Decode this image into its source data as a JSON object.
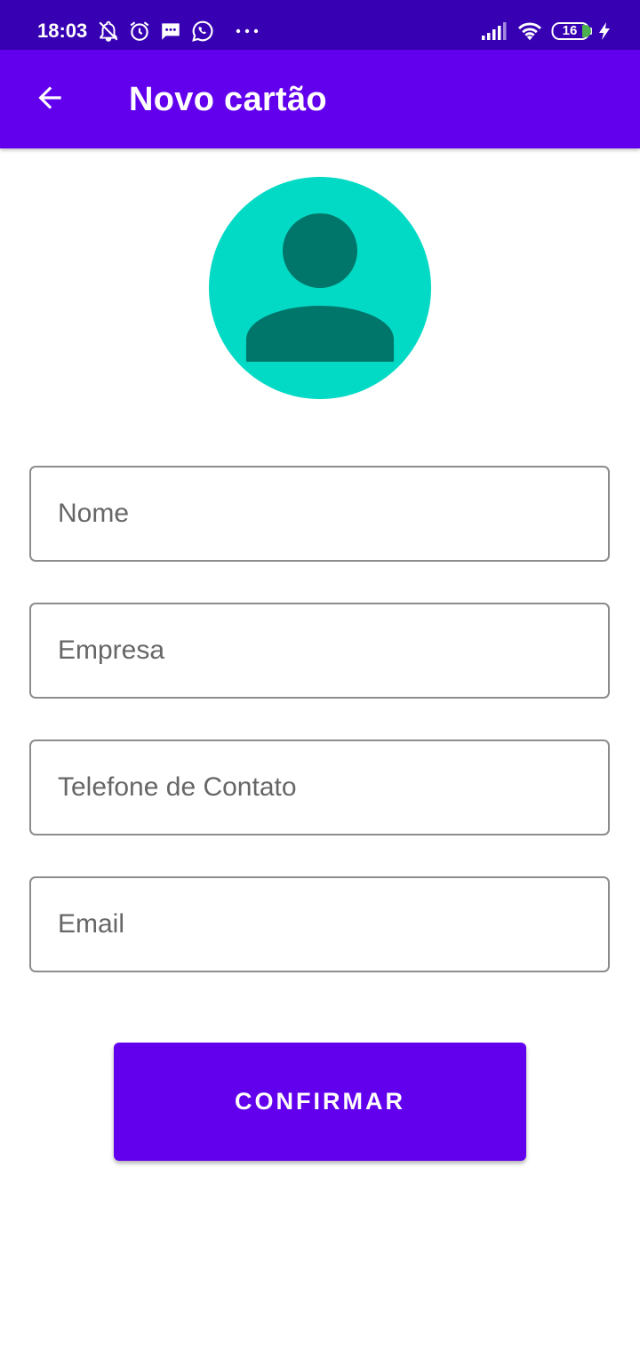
{
  "status_bar": {
    "time": "18:03",
    "battery_level": "16",
    "icons": [
      "notifications-off-icon",
      "alarm-icon",
      "message-icon",
      "whatsapp-icon",
      "more-dots-icon",
      "signal-icon",
      "wifi-icon",
      "battery-icon",
      "charging-icon"
    ]
  },
  "app_bar": {
    "back_icon": "arrow-left-icon",
    "title": "Novo cartão"
  },
  "avatar": {
    "icon": "person-icon",
    "background_color": "#03dac5",
    "figure_color": "#00766a"
  },
  "form": {
    "fields": [
      {
        "placeholder": "Nome",
        "value": ""
      },
      {
        "placeholder": "Empresa",
        "value": ""
      },
      {
        "placeholder": "Telefone de Contato",
        "value": ""
      },
      {
        "placeholder": "Email",
        "value": ""
      }
    ],
    "confirm_label": "CONFIRMAR"
  },
  "colors": {
    "status_bar": "#3700b3",
    "primary": "#6200ee",
    "field_border": "#8d8d8d",
    "placeholder": "#666666"
  }
}
